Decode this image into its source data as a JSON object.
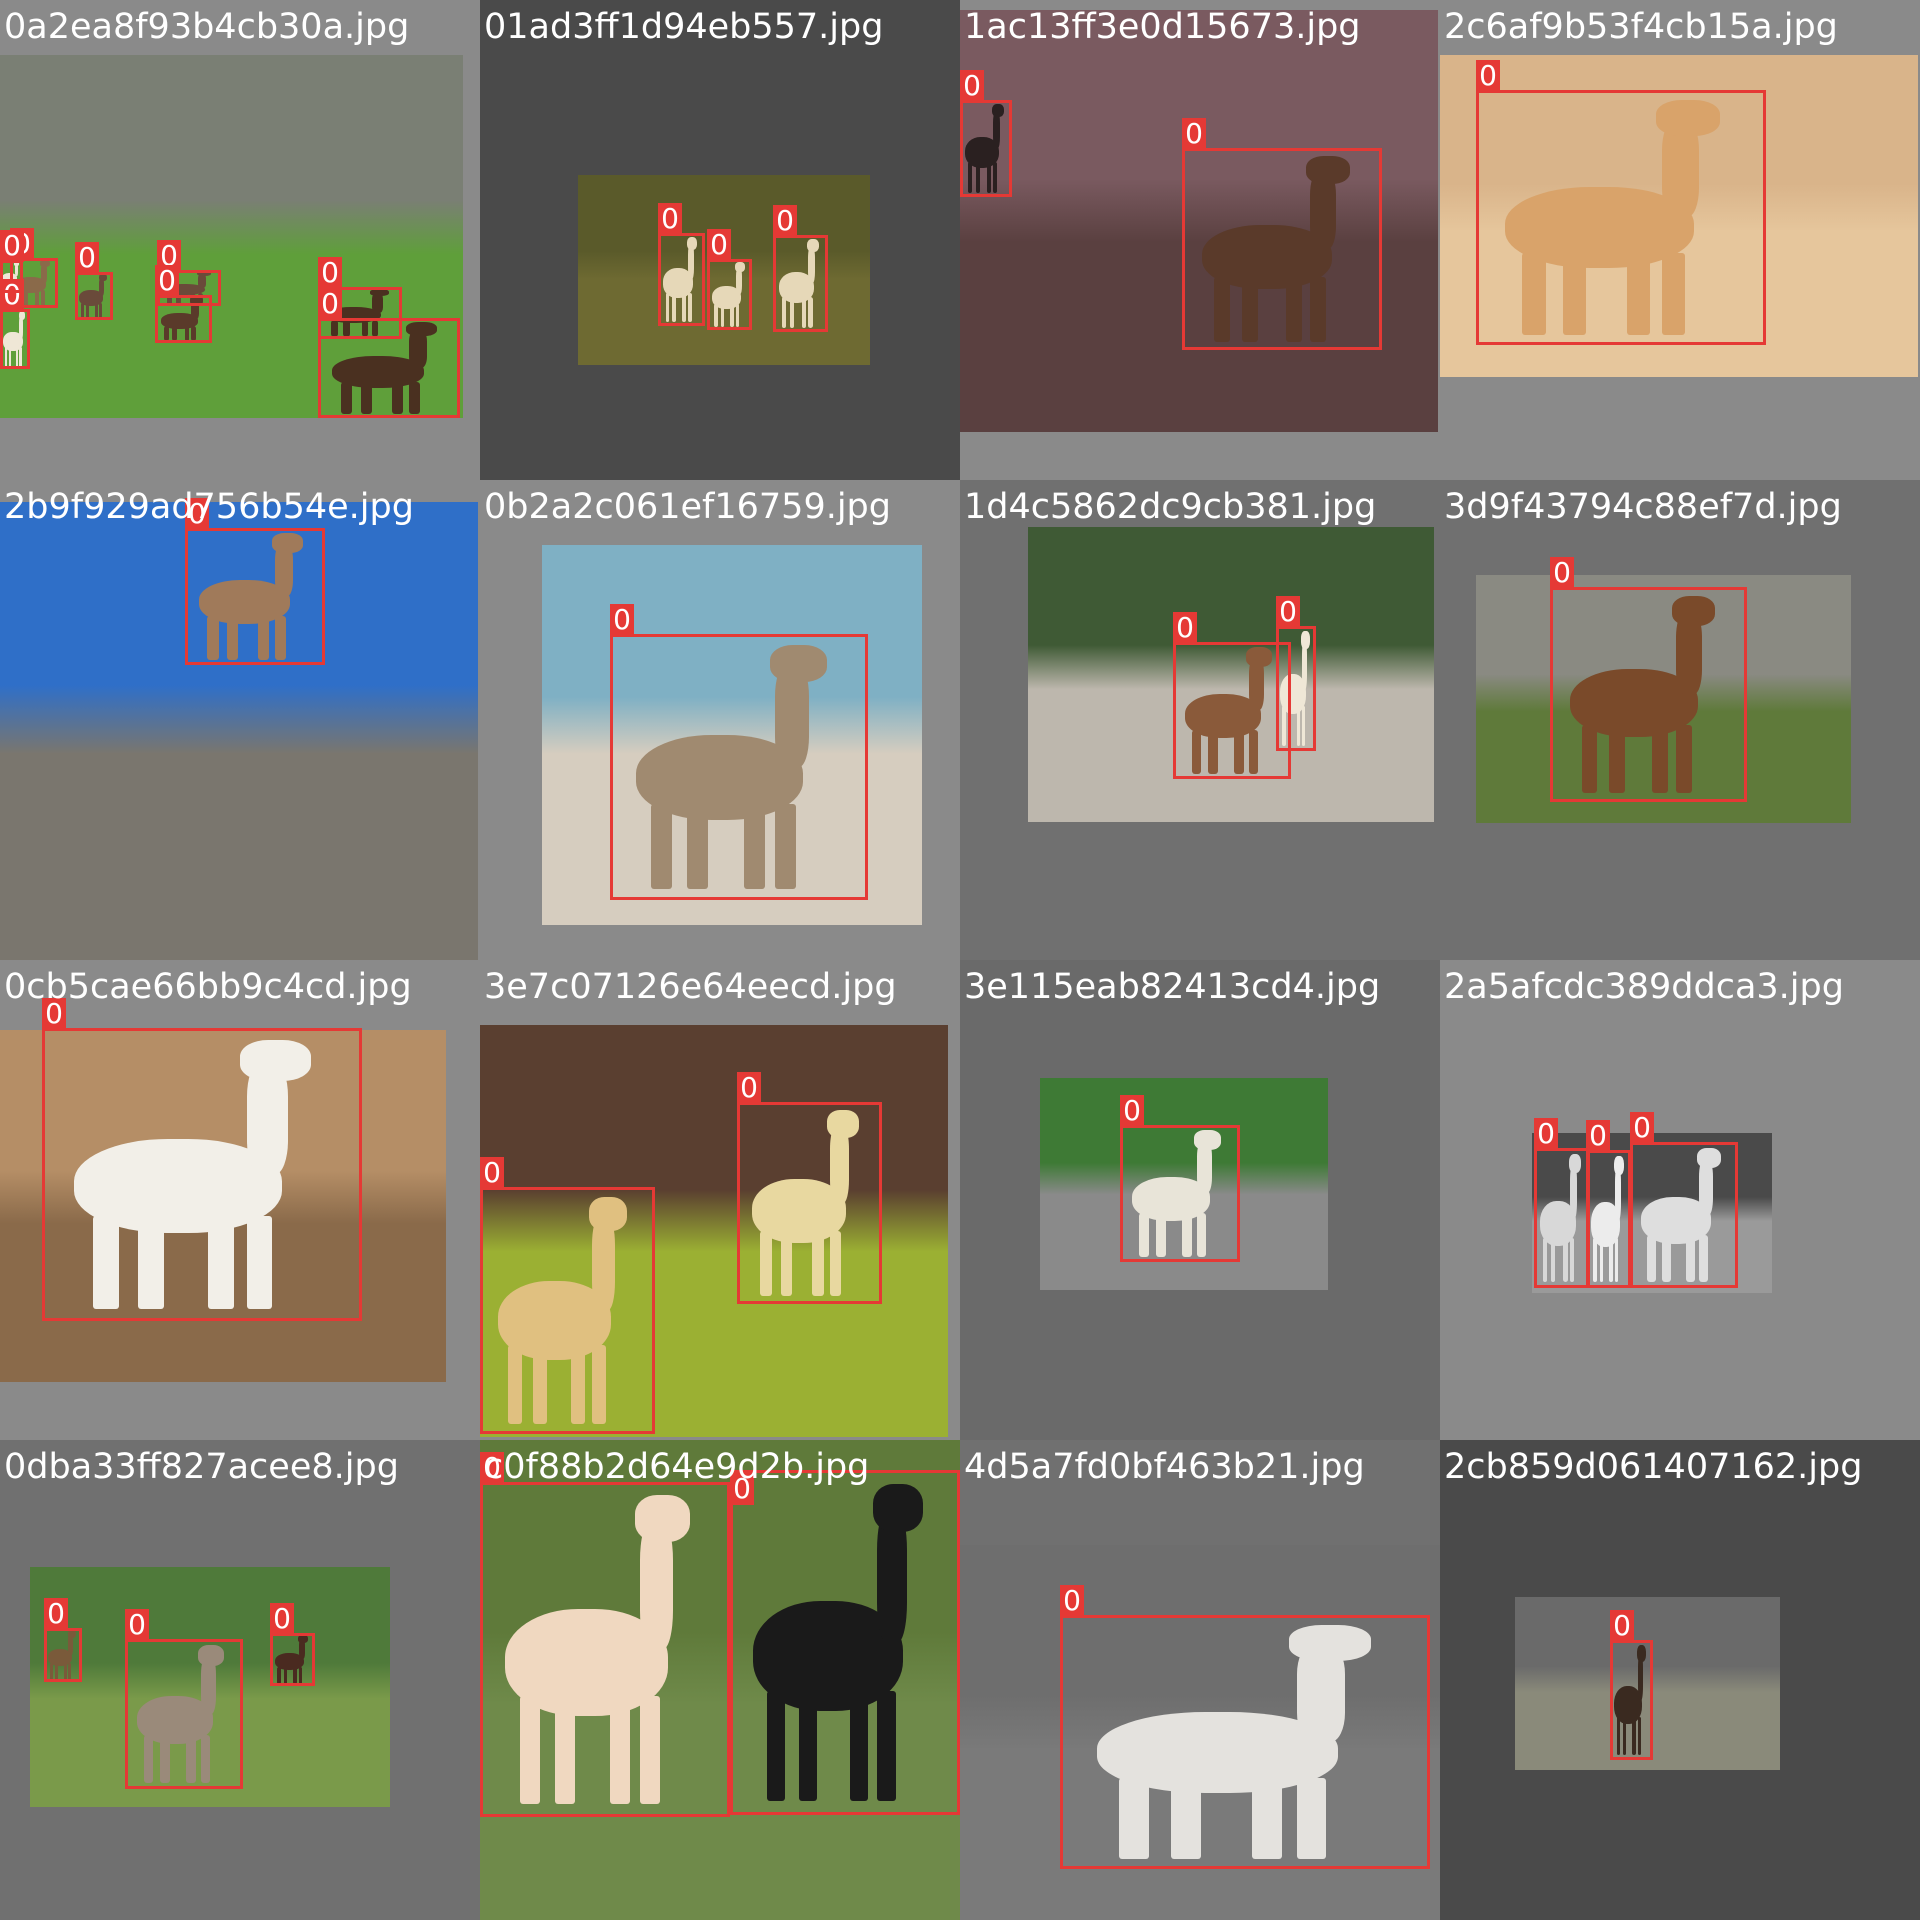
{
  "class_label": "0",
  "colors": {
    "box": "#e53935",
    "tile_bg_light": "#8a8a8a",
    "tile_bg_dark": "#4a4a4a",
    "text": "#ffffff"
  },
  "tiles": [
    {
      "filename": "0a2ea8f93b4cb30a.jpg",
      "bg": "#8a8a8a",
      "scene": [
        "#7a7f74",
        "#5f9f3a"
      ],
      "animals": 9
    },
    {
      "filename": "01ad3ff1d94eb557.jpg",
      "bg": "#4a4a4a",
      "scene": [
        "#5a5a2a",
        "#6e6a32"
      ],
      "animals": 3
    },
    {
      "filename": "1ac13ff3e0d15673.jpg",
      "bg": "#8a8a8a",
      "scene": [
        "#7a5a60",
        "#5a4040"
      ],
      "animals": 2
    },
    {
      "filename": "2c6af9b53f4cb15a.jpg",
      "bg": "#8a8a8a",
      "scene": [
        "#d9b48a",
        "#e6c69c"
      ],
      "animals": 1
    },
    {
      "filename": "2b9f929ad756b54e.jpg",
      "bg": "#8a8a8a",
      "scene": [
        "#2f6fc8",
        "#7a766e"
      ],
      "animals": 1
    },
    {
      "filename": "0b2a2c061ef16759.jpg",
      "bg": "#8a8a8a",
      "scene": [
        "#7fb0c4",
        "#d6cdbf"
      ],
      "animals": 1
    },
    {
      "filename": "1d4c5862dc9cb381.jpg",
      "bg": "#707070",
      "scene": [
        "#3f5a35",
        "#bdb7ad"
      ],
      "animals": 2
    },
    {
      "filename": "3d9f43794c88ef7d.jpg",
      "bg": "#707070",
      "scene": [
        "#8a8a82",
        "#5f7a3a"
      ],
      "animals": 1
    },
    {
      "filename": "0cb5cae66bb9c4cd.jpg",
      "bg": "#8a8a8a",
      "scene": [
        "#b58e66",
        "#8a6a4a"
      ],
      "animals": 1
    },
    {
      "filename": "3e7c07126e64eecd.jpg",
      "bg": "#8a8a8a",
      "scene": [
        "#5a3f30",
        "#9bb033"
      ],
      "animals": 2
    },
    {
      "filename": "3e115eab82413cd4.jpg",
      "bg": "#6a6a6a",
      "scene": [
        "#3e7a35",
        "#8a8a8a"
      ],
      "animals": 1
    },
    {
      "filename": "2a5afcdc389ddca3.jpg",
      "bg": "#8a8a8a",
      "scene": [
        "#4a4a4a",
        "#9a9a9a"
      ],
      "animals": 3
    },
    {
      "filename": "0dba33ff827acee8.jpg",
      "bg": "#707070",
      "scene": [
        "#4f7a3a",
        "#7a9a4a"
      ],
      "animals": 3
    },
    {
      "filename": "c0f88b2d64e9d2b.jpg",
      "bg": "#8a8a8a",
      "scene": [
        "#5f7a3a",
        "#6f8a4a"
      ],
      "animals": 2
    },
    {
      "filename": "4d5a7fd0bf463b21.jpg",
      "bg": "#707070",
      "scene": [
        "#6e6e6e",
        "#7a7a7a"
      ],
      "animals": 1
    },
    {
      "filename": "2cb859d061407162.jpg",
      "bg": "#4a4a4a",
      "scene": [
        "#6a6a6a",
        "#8a8a7a"
      ],
      "animals": 1
    }
  ]
}
